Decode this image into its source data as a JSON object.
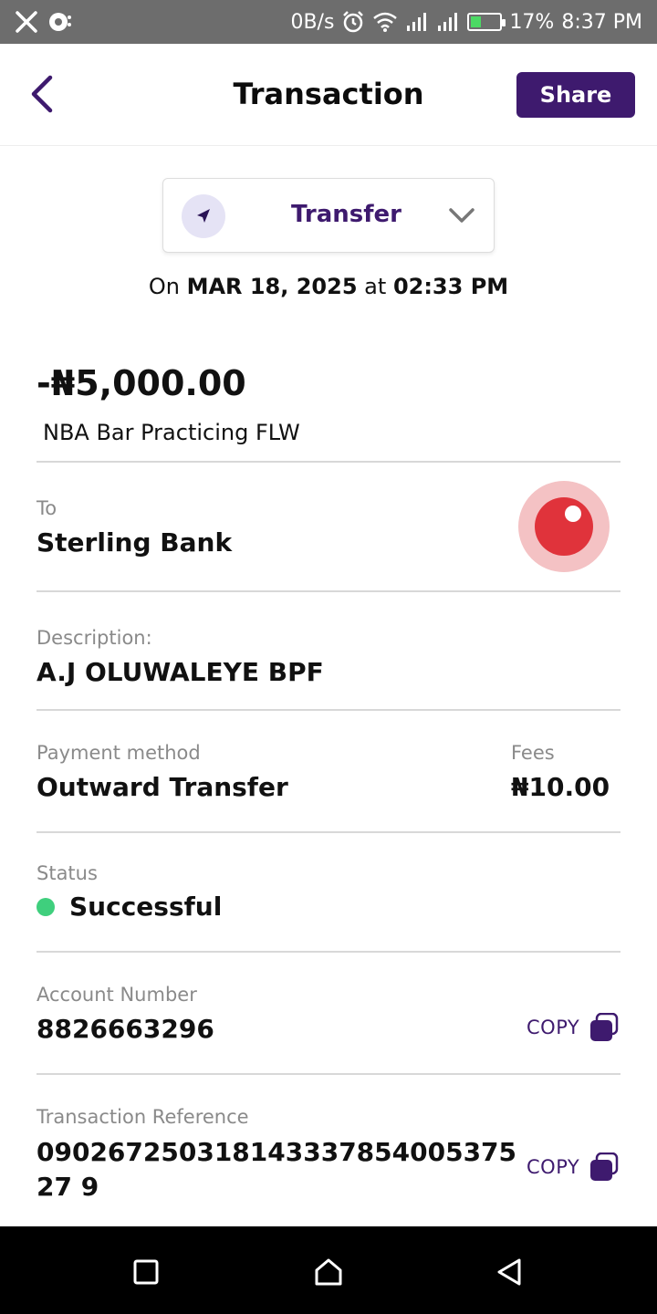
{
  "status_bar": {
    "network_speed": "0B/s",
    "battery_percent": "17%",
    "time": "8:37 PM"
  },
  "header": {
    "title": "Transaction",
    "share_label": "Share"
  },
  "transaction_type": {
    "label": "Transfer"
  },
  "date": {
    "prefix": "On",
    "date": "MAR 18, 2025",
    "connector": "at",
    "time": "02:33 PM"
  },
  "summary": {
    "amount": "-₦5,000.00",
    "merchant": "NBA Bar Practicing FLW"
  },
  "recipient": {
    "label": "To",
    "bank": "Sterling Bank"
  },
  "description": {
    "label": "Description:",
    "value": "A.J OLUWALEYE BPF"
  },
  "payment": {
    "method_label": "Payment method",
    "method_value": "Outward Transfer",
    "fees_label": "Fees",
    "fees_value": "₦10.00"
  },
  "status": {
    "label": "Status",
    "value": "Successful",
    "color": "#3fcf7d"
  },
  "account": {
    "label": "Account Number",
    "value": "8826663296",
    "copy_label": "COPY"
  },
  "reference": {
    "label": "Transaction Reference",
    "value": "09026725031814333785400537527 9",
    "copy_label": "COPY"
  },
  "theme": {
    "accent": "#3e1a6e",
    "bank_logo_color": "#e0333b"
  }
}
